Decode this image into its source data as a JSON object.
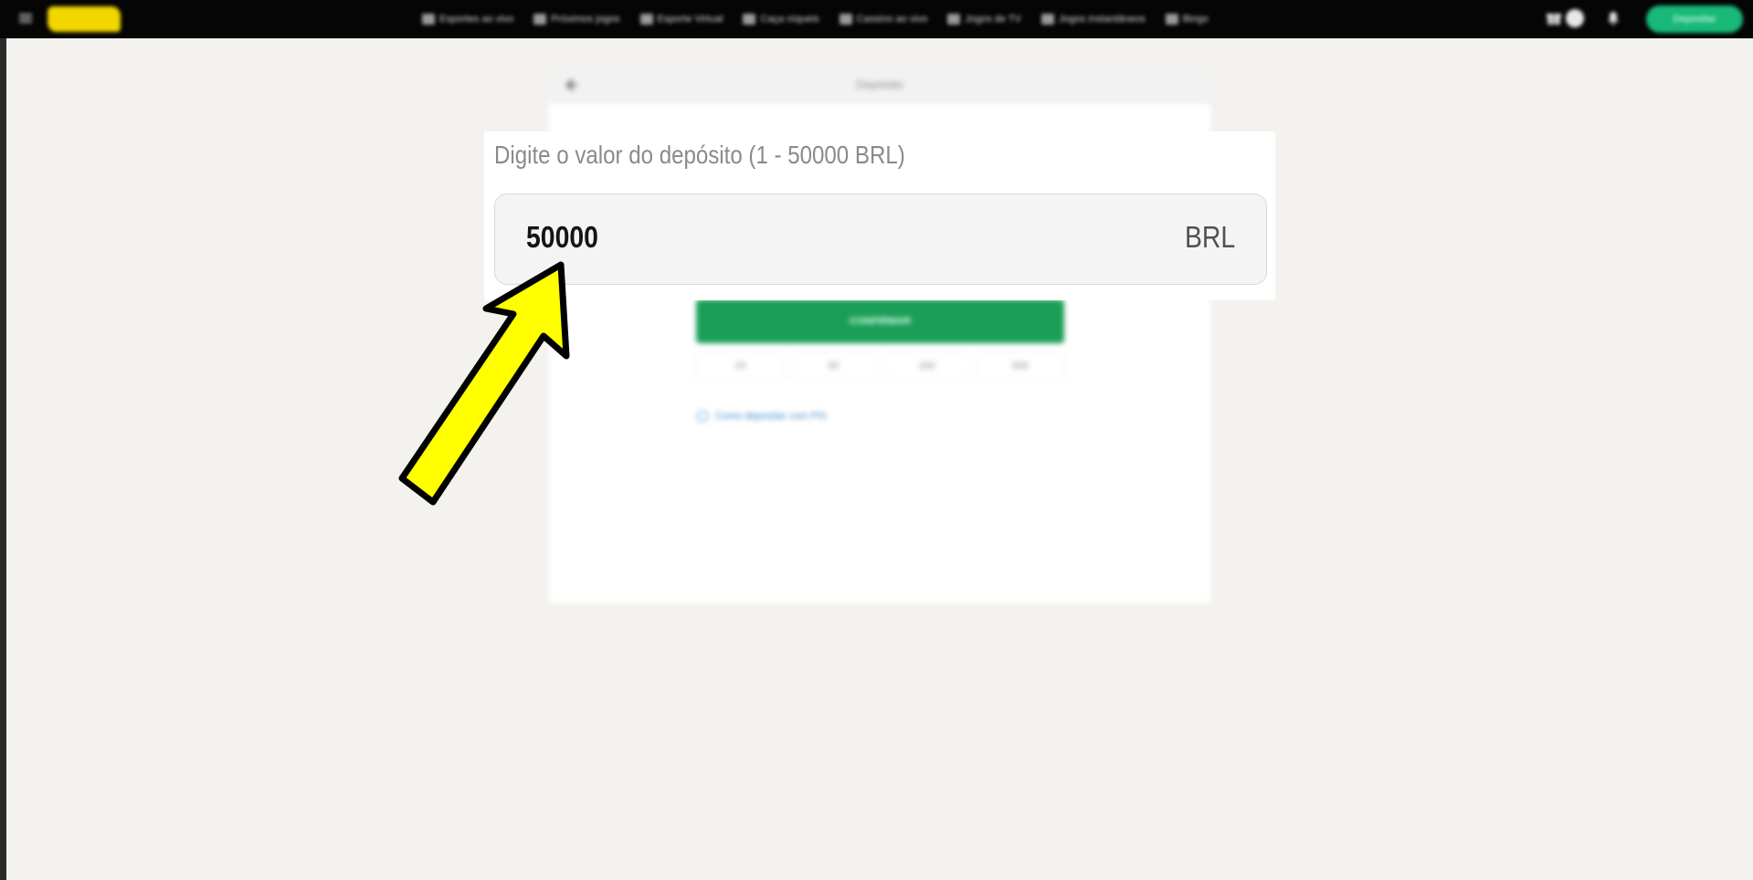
{
  "topbar": {
    "nav_items": [
      {
        "label": "Esportes ao vivo",
        "icon": "live-icon"
      },
      {
        "label": "Próximos jogos",
        "icon": "calendar-icon"
      },
      {
        "label": "Esporte Virtual",
        "icon": "monitor-icon"
      },
      {
        "label": "Caça níqueis",
        "icon": "slot-icon"
      },
      {
        "label": "Cassino ao vivo",
        "icon": "casino-icon"
      },
      {
        "label": "Jogos de TV",
        "icon": "tv-icon"
      },
      {
        "label": "Jogos instantâneos",
        "icon": "bolt-icon"
      },
      {
        "label": "Bingo",
        "icon": "bingo-icon"
      }
    ],
    "deposit_button": "Depositar"
  },
  "panel": {
    "title": "Depósito",
    "confirm_button": "CONFIRMAR",
    "quick_amounts": [
      "15",
      "50",
      "100",
      "500"
    ],
    "help_link": "Como depositar com PIX"
  },
  "zoom": {
    "label": "Digite o valor do depósito (1 - 50000 BRL)",
    "amount_value": "50000",
    "currency": "BRL"
  },
  "colors": {
    "accent_green": "#1a9e57",
    "arrow_yellow": "#ffff00",
    "topbar": "#050505"
  }
}
